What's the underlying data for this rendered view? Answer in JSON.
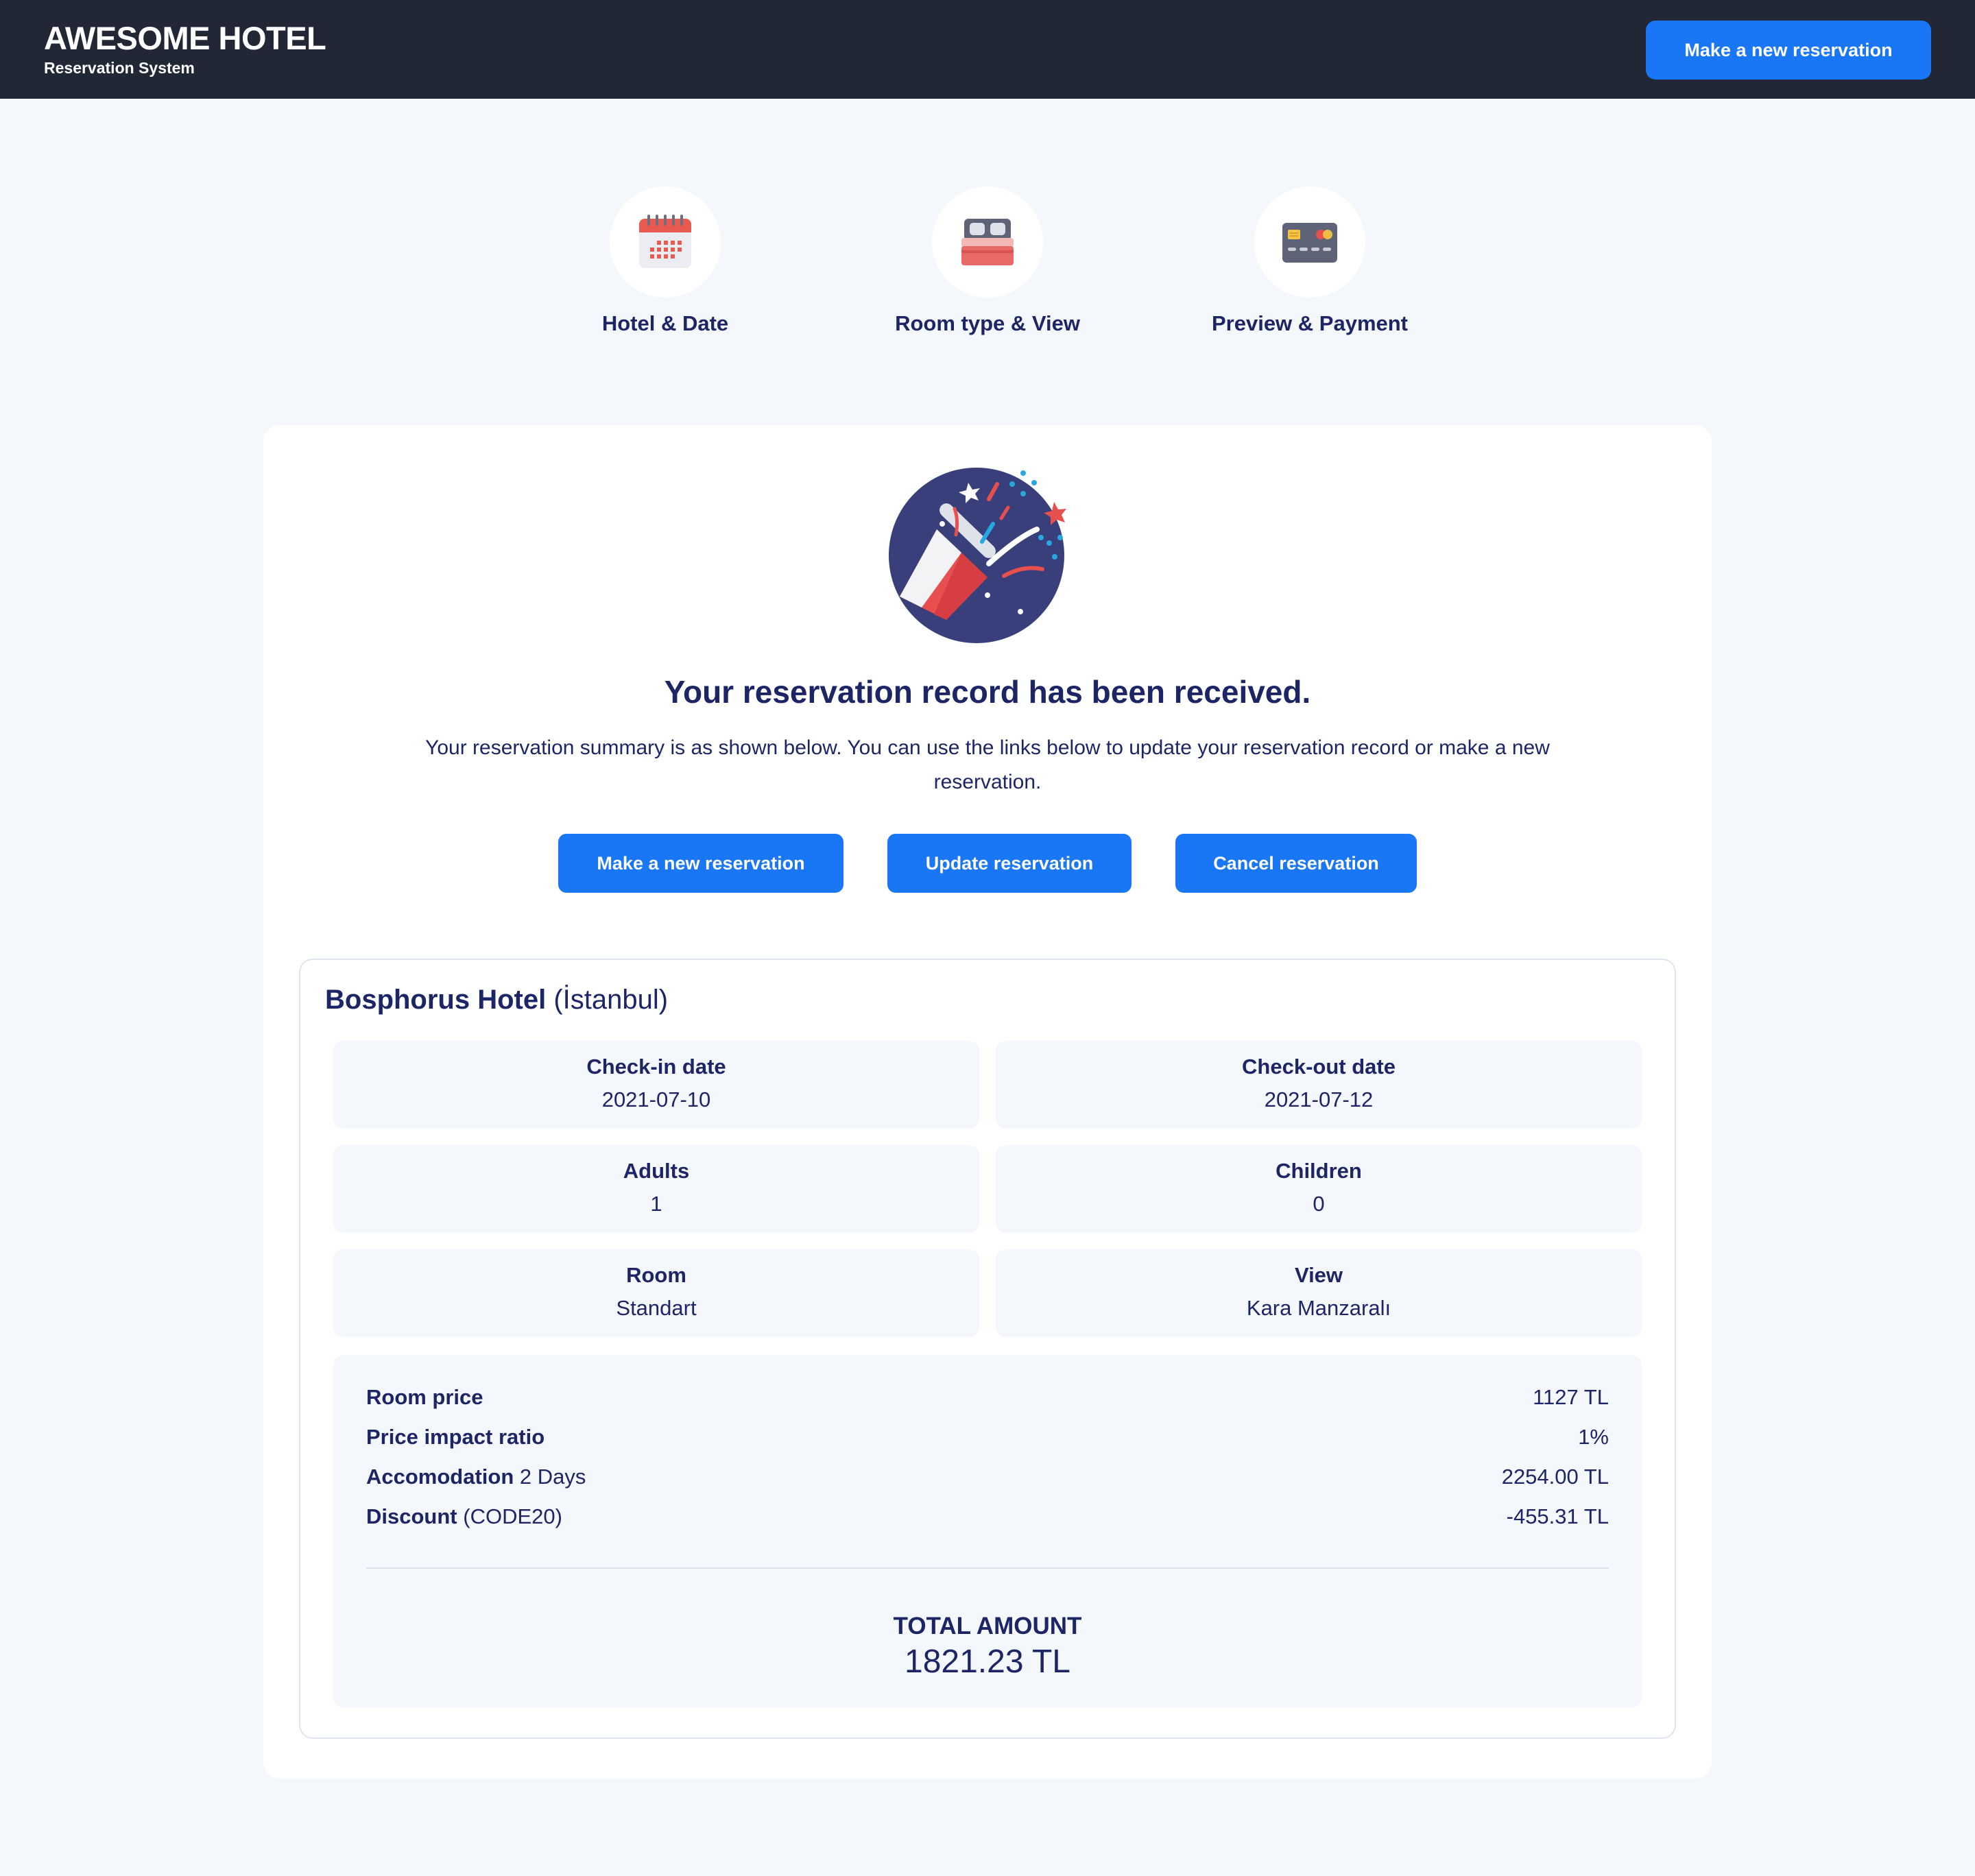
{
  "header": {
    "title": "AWESOME HOTEL",
    "subtitle": "Reservation System",
    "new_reservation_label": "Make a new reservation"
  },
  "steps": [
    {
      "label": "Hotel & Date",
      "icon": "calendar-icon"
    },
    {
      "label": "Room type & View",
      "icon": "bed-icon"
    },
    {
      "label": "Preview & Payment",
      "icon": "credit-card-icon"
    }
  ],
  "confirmation": {
    "icon": "party-popper-icon",
    "title": "Your reservation record has been received.",
    "description": "Your reservation summary is as shown below. You can use the links below to update your reservation record or make a new reservation.",
    "buttons": {
      "new": "Make a new reservation",
      "update": "Update reservation",
      "cancel": "Cancel reservation"
    }
  },
  "summary": {
    "hotel_name": "Bosphorus Hotel",
    "hotel_city": "(İstanbul)",
    "checkin_label": "Check-in date",
    "checkin_value": "2021-07-10",
    "checkout_label": "Check-out date",
    "checkout_value": "2021-07-12",
    "adults_label": "Adults",
    "adults_value": "1",
    "children_label": "Children",
    "children_value": "0",
    "room_label": "Room",
    "room_value": "Standart",
    "view_label": "View",
    "view_value": "Kara Manzaralı",
    "room_price_label": "Room price",
    "room_price_value": "1127 TL",
    "impact_label": "Price impact ratio",
    "impact_value": "1%",
    "accommodation_label": "Accomodation",
    "accommodation_days": "2 Days",
    "accommodation_value": "2254.00 TL",
    "discount_label": "Discount",
    "discount_code": "(CODE20)",
    "discount_value": "-455.31 TL",
    "total_label": "TOTAL AMOUNT",
    "total_value": "1821.23 TL"
  },
  "colors": {
    "header_bg": "#222736",
    "accent": "#1976f5",
    "page_bg": "#f4f7fc",
    "text": "#1c2566"
  }
}
